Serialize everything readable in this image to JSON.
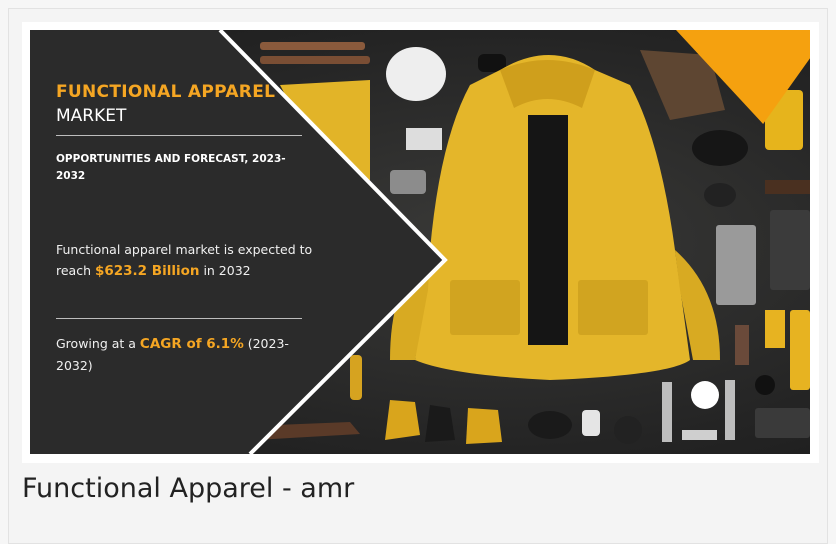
{
  "banner": {
    "title_highlight": "FUNCTIONAL APPAREL",
    "title_sub": "MARKET",
    "opportunities": "OPPORTUNITIES AND FORECAST, 2023-2032",
    "stat1_pre": "Functional apparel market is expected to reach ",
    "stat1_value": "$623.2 Billion",
    "stat1_post": " in 2032",
    "stat2_pre": "Growing at a ",
    "stat2_value": "CAGR of 6.1%",
    "stat2_post": " (2023-2032)",
    "accent_color": "#f5a623",
    "panel_color": "#2b2b2b",
    "photo_subject": "yellow rain jacket flat-lay with outdoor gear"
  },
  "caption": "Functional Apparel - amr"
}
